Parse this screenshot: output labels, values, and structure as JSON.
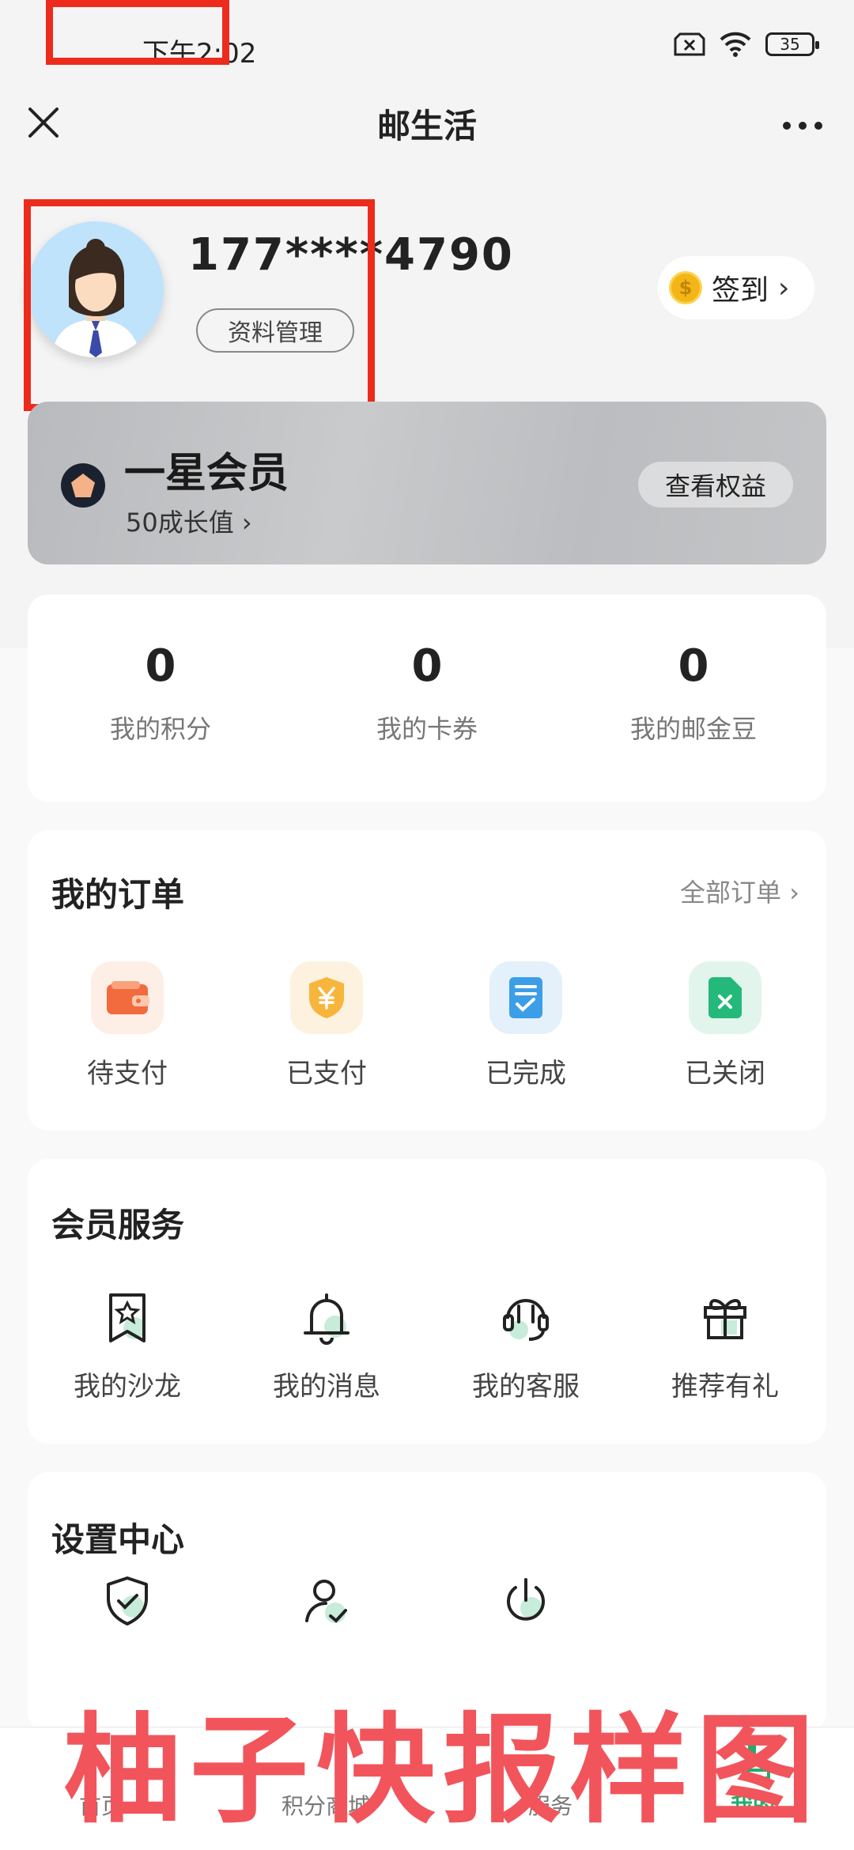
{
  "status_bar": {
    "time": "下午2:02",
    "battery": "35"
  },
  "header": {
    "title": "邮生活"
  },
  "profile": {
    "phone": "177****4790",
    "profile_button": "资料管理",
    "signin_label": "签到",
    "coin_symbol": "$"
  },
  "member": {
    "title": "一星会员",
    "growth": "50成长值 ›",
    "rights_button": "查看权益"
  },
  "stats": [
    {
      "value": "0",
      "label": "我的积分"
    },
    {
      "value": "0",
      "label": "我的卡券"
    },
    {
      "value": "0",
      "label": "我的邮金豆"
    }
  ],
  "orders": {
    "title": "我的订单",
    "all_link": "全部订单 ›",
    "items": [
      {
        "label": "待支付",
        "icon": "wallet-icon",
        "bg": "#fdeee6"
      },
      {
        "label": "已支付",
        "icon": "yuan-shield-icon",
        "bg": "#fdf2df"
      },
      {
        "label": "已完成",
        "icon": "checklist-icon",
        "bg": "#e4f1fb"
      },
      {
        "label": "已关闭",
        "icon": "closed-doc-icon",
        "bg": "#e2f5ec"
      }
    ]
  },
  "member_services": {
    "title": "会员服务",
    "items": [
      {
        "label": "我的沙龙",
        "icon": "salon-bookmark-icon"
      },
      {
        "label": "我的消息",
        "icon": "bell-icon"
      },
      {
        "label": "我的客服",
        "icon": "headset-icon"
      },
      {
        "label": "推荐有礼",
        "icon": "gift-icon"
      }
    ]
  },
  "settings": {
    "title": "设置中心",
    "items": [
      {
        "icon": "shield-check-icon"
      },
      {
        "icon": "user-check-icon"
      },
      {
        "icon": "power-icon"
      }
    ]
  },
  "tabbar": {
    "items": [
      {
        "label": "首页"
      },
      {
        "label": "积分商城"
      },
      {
        "label": "服务"
      },
      {
        "label": "我的",
        "active": true
      }
    ]
  },
  "watermark": "柚子快报样图",
  "colors": {
    "accent": "#1fae6a",
    "annotation_red": "#ec2b1c",
    "watermark": "#f2545b"
  }
}
